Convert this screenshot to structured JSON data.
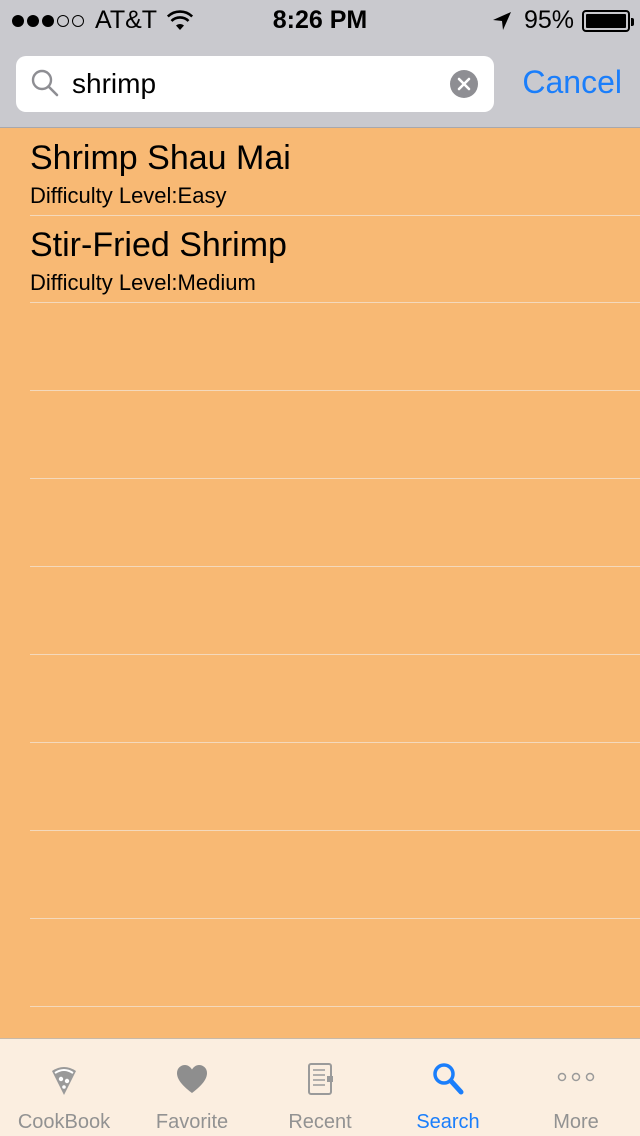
{
  "status_bar": {
    "carrier": "AT&T",
    "time": "8:26 PM",
    "battery": "95%",
    "signal_bars_filled": 3,
    "signal_bars_total": 5
  },
  "search": {
    "value": "shrimp",
    "cancel_label": "Cancel"
  },
  "results": [
    {
      "title": "Shrimp Shau Mai",
      "subtitle": "Difficulty Level:Easy"
    },
    {
      "title": "Stir-Fried Shrimp",
      "subtitle": "Difficulty Level:Medium"
    }
  ],
  "tabbar": {
    "tabs": [
      {
        "label": "CookBook",
        "icon": "cookbook-icon"
      },
      {
        "label": "Favorite",
        "icon": "heart-icon"
      },
      {
        "label": "Recent",
        "icon": "notebook-icon"
      },
      {
        "label": "Search",
        "icon": "search-icon"
      },
      {
        "label": "More",
        "icon": "more-icon"
      }
    ],
    "active": "Search"
  },
  "colors": {
    "accent": "#1a7efb",
    "list_background": "#f8b974",
    "header_background": "#c9c9ce",
    "tabbar_background": "#fbeee0"
  }
}
